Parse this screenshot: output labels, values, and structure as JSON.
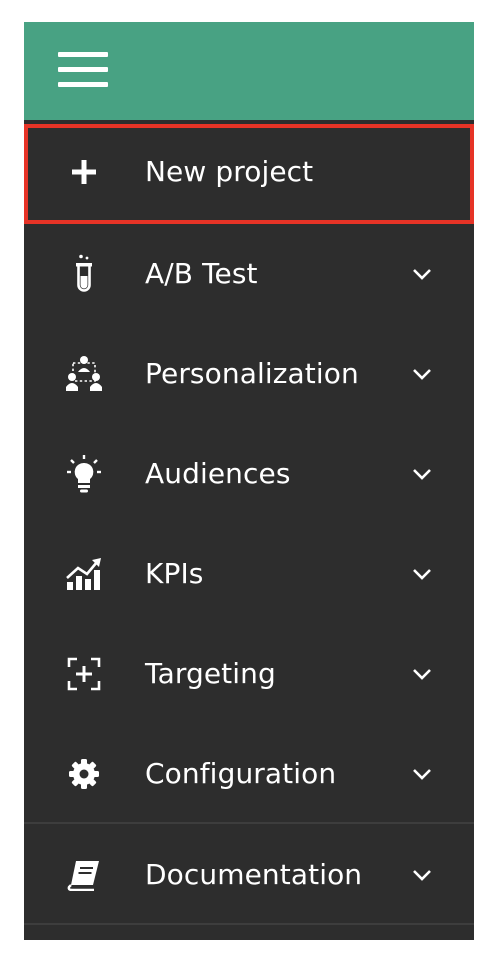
{
  "header": {
    "menu_icon": "hamburger-menu-icon",
    "background_color": "#48a283"
  },
  "sidebar": {
    "background_color": "#2d2d2d",
    "highlight_color": "#e63326",
    "items": [
      {
        "label": "New project",
        "icon": "plus-icon",
        "has_chevron": false,
        "highlighted": true
      },
      {
        "label": "A/B Test",
        "icon": "test-tube-icon",
        "has_chevron": true
      },
      {
        "label": "Personalization",
        "icon": "personalization-icon",
        "has_chevron": true
      },
      {
        "label": "Audiences",
        "icon": "lightbulb-icon",
        "has_chevron": true
      },
      {
        "label": "KPIs",
        "icon": "growth-chart-icon",
        "has_chevron": true
      },
      {
        "label": "Targeting",
        "icon": "targeting-icon",
        "has_chevron": true
      },
      {
        "label": "Configuration",
        "icon": "gear-icon",
        "has_chevron": true
      },
      {
        "label": "Documentation",
        "icon": "book-icon",
        "has_chevron": true
      }
    ]
  }
}
